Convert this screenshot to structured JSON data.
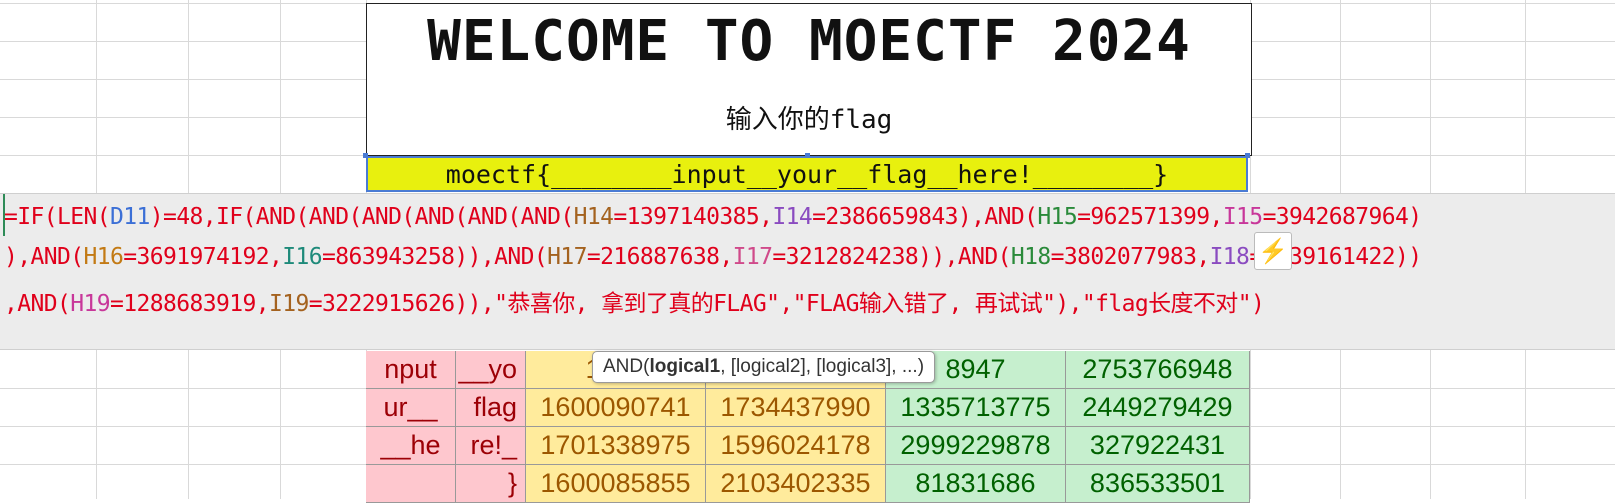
{
  "sheet": {
    "title": "WELCOME TO MOECTF 2024",
    "prompt": "输入你的flag",
    "flag_input_value": "moectf{________input__your__flag__here!________}"
  },
  "formula_bar": {
    "line1": [
      {
        "t": "=IF(LEN(",
        "c": "plain"
      },
      {
        "t": "D11",
        "c": "blue"
      },
      {
        "t": ")=48,IF(AND(AND(AND(AND(AND(AND(",
        "c": "plain"
      },
      {
        "t": "H14",
        "c": "brown"
      },
      {
        "t": "=1397140385,",
        "c": "plain"
      },
      {
        "t": "I14",
        "c": "purple"
      },
      {
        "t": "=2386659843),AND(",
        "c": "plain"
      },
      {
        "t": "H15",
        "c": "green"
      },
      {
        "t": "=962571399,",
        "c": "plain"
      },
      {
        "t": "I15",
        "c": "magenta"
      },
      {
        "t": "=3942687964)",
        "c": "plain"
      }
    ],
    "line2": [
      {
        "t": "),AND(",
        "c": "plain"
      },
      {
        "t": "H16",
        "c": "orange"
      },
      {
        "t": "=3691974192,",
        "c": "plain"
      },
      {
        "t": "I16",
        "c": "teal"
      },
      {
        "t": "=863943258)),AND(",
        "c": "plain"
      },
      {
        "t": "H17",
        "c": "brown"
      },
      {
        "t": "=216887638,",
        "c": "plain"
      },
      {
        "t": "I17",
        "c": "pink"
      },
      {
        "t": "=3212824238)),AND(",
        "c": "plain"
      },
      {
        "t": "H18",
        "c": "green"
      },
      {
        "t": "=3802077983,",
        "c": "plain"
      },
      {
        "t": "I18",
        "c": "purple"
      },
      {
        "t": "=1839161422))",
        "c": "plain"
      }
    ],
    "line3": [
      {
        "t": ",AND(",
        "c": "plain"
      },
      {
        "t": "H19",
        "c": "magenta"
      },
      {
        "t": "=1288683919,",
        "c": "plain"
      },
      {
        "t": "I19",
        "c": "brown"
      },
      {
        "t": "=3222915626)),\"恭喜你, 拿到了真的FLAG\",\"FLAG输入错了, 再试试\"),\"flag长度不对\")",
        "c": "plain"
      }
    ]
  },
  "tooltip": {
    "fn": "AND(",
    "arg_bold": "logical1",
    "rest": ", [logical2], [logical3], ...)"
  },
  "table": {
    "rows": [
      {
        "a": "nput",
        "b": "__yo",
        "h": "1953",
        "i": "",
        "j": "8947",
        "k": "2753766948"
      },
      {
        "a": "ur__",
        "b": "flag",
        "h": "1600090741",
        "i": "1734437990",
        "j": "1335713775",
        "k": "2449279429"
      },
      {
        "a": "__he",
        "b": "re!_",
        "h": "1701338975",
        "i": "1596024178",
        "j": "2999229878",
        "k": "327922431"
      },
      {
        "a": "",
        "b": "}",
        "h": "1600085855",
        "i": "2103402335",
        "j": "81831686",
        "k": "836533501"
      }
    ]
  },
  "colors": {
    "flag_fill": "#e8f00e",
    "formula_text": "#e0001b",
    "str_fill": "#fec7ce",
    "h_fill": "#ffeb9c",
    "i_fill": "#c6efce"
  },
  "icons": {
    "quick_analysis": "lightning-icon"
  }
}
